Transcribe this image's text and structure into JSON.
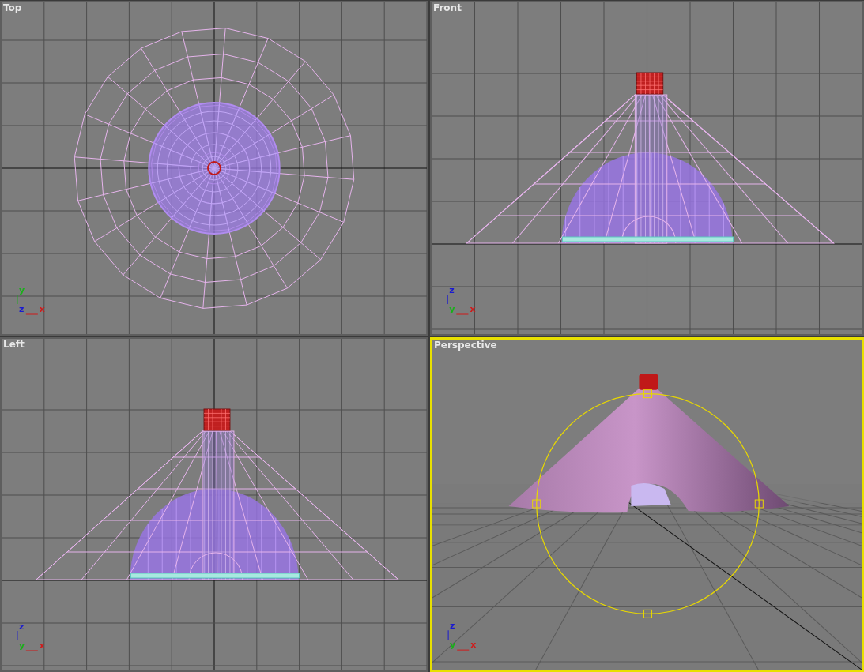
{
  "viewports": [
    {
      "title": "Top",
      "kind": "top",
      "selected": false,
      "axes": [
        {
          "label": "y",
          "color": "#19b019"
        },
        {
          "label": "z",
          "color": "#1a1ad0"
        },
        {
          "label": "x",
          "color": "#d01a1a"
        }
      ]
    },
    {
      "title": "Front",
      "kind": "front",
      "selected": false,
      "axes": [
        {
          "label": "z",
          "color": "#1a1ad0"
        },
        {
          "label": "y",
          "color": "#19b019"
        },
        {
          "label": "x",
          "color": "#d01a1a"
        }
      ]
    },
    {
      "title": "Left",
      "kind": "left",
      "selected": false,
      "axes": [
        {
          "label": "z",
          "color": "#1a1ad0"
        },
        {
          "label": "y",
          "color": "#19b019"
        },
        {
          "label": "x",
          "color": "#d01a1a"
        }
      ]
    },
    {
      "title": "Perspective",
      "kind": "perspective",
      "selected": true,
      "axes": [
        {
          "label": "z",
          "color": "#1a1ad0"
        },
        {
          "label": "y",
          "color": "#19b019"
        },
        {
          "label": "x",
          "color": "#d01a1a"
        }
      ]
    }
  ]
}
